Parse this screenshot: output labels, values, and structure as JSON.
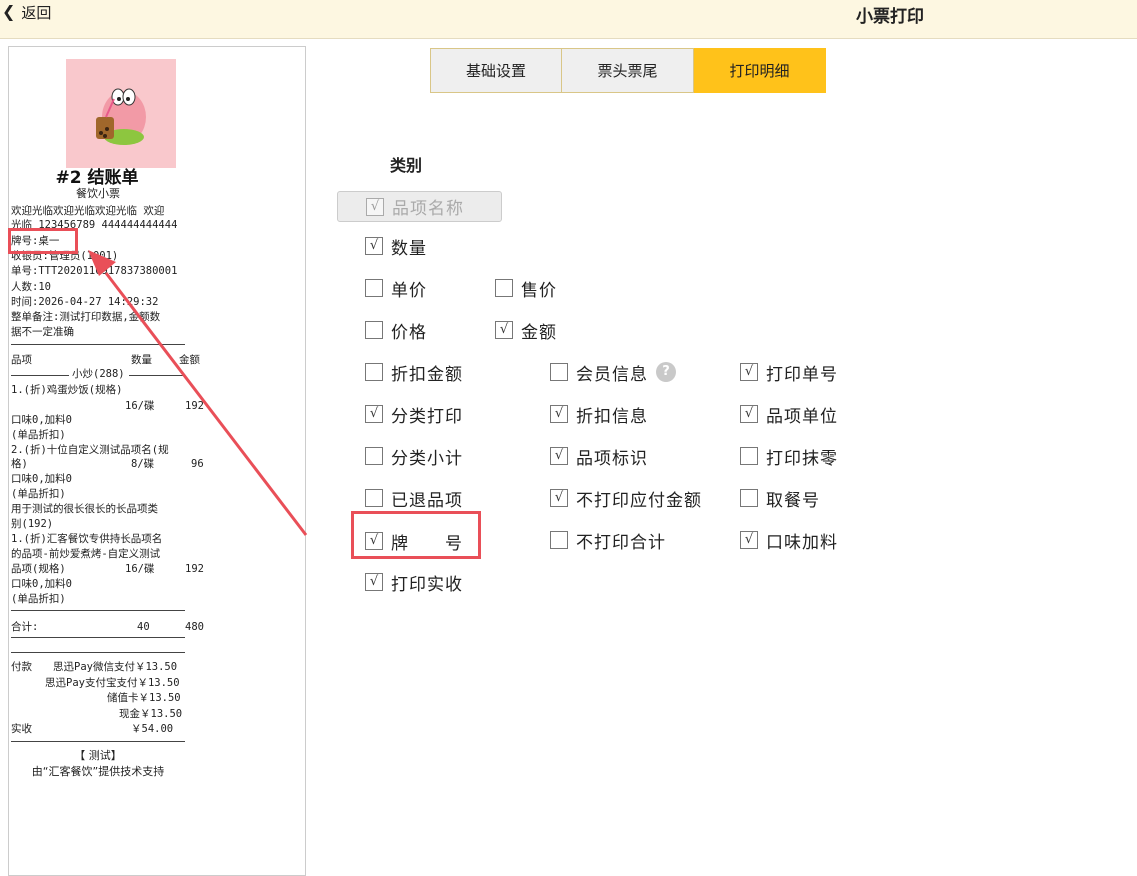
{
  "header": {
    "back_label": "返回",
    "title": "小票打印"
  },
  "tabs": [
    {
      "label": "基础设置",
      "active": false
    },
    {
      "label": "票头票尾",
      "active": false
    },
    {
      "label": "打印明细",
      "active": true
    }
  ],
  "accent_color": "#ffc21a",
  "highlight_color": "#e94f58",
  "receipt": {
    "title": "#2 结账单",
    "subtitle": "餐饮小票",
    "welcome_1": "欢迎光临欢迎光临欢迎光临 欢迎",
    "welcome_2": "光临   123456789 444444444444",
    "plate": "牌号:桌一",
    "cashier": "收银员:管理员(1001)",
    "order_no": "单号:TTT2020110917837380001",
    "people": "人数:10",
    "time": "时间:2026-04-27 14:29:32",
    "remark_1": "整单备注:测试打印数据,金额数",
    "remark_2": "据不一定准确",
    "col_item": "品项",
    "col_qty": "数量",
    "col_amount": "金额",
    "category_1": "小炒(288)",
    "i1_name": "1.(折)鸡蛋炒饭(规格)",
    "i1_qty": "16/碟",
    "i1_amt": "192",
    "i1_flavor": "口味0,加料0",
    "i1_disc": "(单品折扣)",
    "i2_name_1": "2.(折)十位自定义测试品项名(规",
    "i2_name_2": "格)",
    "i2_qty": "8/碟",
    "i2_amt": "96",
    "i2_flavor": "口味0,加料0",
    "i2_disc": "(单品折扣)",
    "category_2a": "用于测试的很长很长的长品项类",
    "category_2b": "别(192)",
    "i3_name_1": "1.(折)汇客餐饮专供持长品项名",
    "i3_name_2": "的品项-前炒爱煮烤-自定义测试",
    "i3_name_3": "品项(规格)",
    "i3_qty": "16/碟",
    "i3_amt": "192",
    "i3_flavor": "口味0,加料0",
    "i3_disc": "(单品折扣)",
    "total_label": "合计:",
    "total_qty": "40",
    "total_amt": "480",
    "pay_label": "付款",
    "pay_1": "思迅Pay微信支付￥13.50",
    "pay_2": "思迅Pay支付宝支付￥13.50",
    "pay_3": "储值卡￥13.50",
    "pay_4": "现金￥13.50",
    "actual_label": "实收",
    "actual_amt": "￥54.00",
    "footer_1": "【 测试】",
    "footer_2": "由“汇客餐饮”提供技术支持"
  },
  "settings": {
    "section_label": "类别",
    "options": {
      "item_name": {
        "label": "品项名称",
        "checked": true,
        "disabled": true
      },
      "quantity": {
        "label": "数量",
        "checked": true
      },
      "unit_price": {
        "label": "单价",
        "checked": false
      },
      "sale_price": {
        "label": "售价",
        "checked": false
      },
      "price": {
        "label": "价格",
        "checked": false
      },
      "amount": {
        "label": "金额",
        "checked": true
      },
      "discount_amount": {
        "label": "折扣金额",
        "checked": false
      },
      "member_info": {
        "label": "会员信息",
        "checked": false
      },
      "print_order_no": {
        "label": "打印单号",
        "checked": true
      },
      "category_print": {
        "label": "分类打印",
        "checked": true
      },
      "discount_info": {
        "label": "折扣信息",
        "checked": true
      },
      "item_unit": {
        "label": "品项单位",
        "checked": true
      },
      "category_subtotal": {
        "label": "分类小计",
        "checked": false
      },
      "item_mark": {
        "label": "品项标识",
        "checked": true
      },
      "print_rounding": {
        "label": "打印抹零",
        "checked": false
      },
      "returned_items": {
        "label": "已退品项",
        "checked": false
      },
      "no_payable_amount": {
        "label": "不打印应付金额",
        "checked": true
      },
      "pickup_no": {
        "label": "取餐号",
        "checked": false
      },
      "plate_no": {
        "label": "牌　　号",
        "checked": true
      },
      "no_total": {
        "label": "不打印合计",
        "checked": false
      },
      "flavor_addon": {
        "label": "口味加料",
        "checked": true
      },
      "print_actual": {
        "label": "打印实收",
        "checked": true
      }
    },
    "help_glyph": "?",
    "check_glyph": "√"
  }
}
